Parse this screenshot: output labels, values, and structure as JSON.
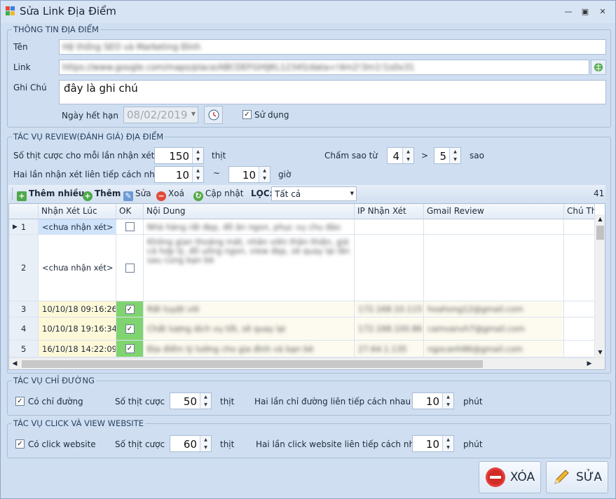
{
  "window": {
    "title": "Sửa Link Địa Điểm"
  },
  "info": {
    "legend": "THÔNG TIN ĐỊA ĐIỂM",
    "name_label": "Tên",
    "name_value": "Hệ thống SEO và Marketing Đình",
    "link_label": "Link",
    "link_value": "https://www.google.com/maps/place/ABCDEFGHIJKL12345/data=!4m2!3m1!1s0x31",
    "note_label": "Ghi Chú",
    "note_value": "đây là ghi chú",
    "expiry_label": "Ngày hết hạn",
    "expiry_value": "08/02/2019",
    "use_label": "Sử dụng"
  },
  "review": {
    "legend": "TÁC VỤ REVIEW(ĐÁNH GIÁ) ĐỊA ĐIỂM",
    "likes_label": "Số thịt cược cho mỗi lần nhận xét",
    "likes_value": "150",
    "likes_unit": "thịt",
    "interval_label": "Hai lần nhận xét liên tiếp cách nhau",
    "interval_from": "10",
    "interval_sep": "~",
    "interval_to": "10",
    "interval_unit": "giờ",
    "stars_label": "Chấm sao từ",
    "stars_from": "4",
    "stars_sep": ">",
    "stars_to": "5",
    "stars_unit": "sao"
  },
  "toolbar": {
    "add_many": "Thêm nhiều",
    "add": "Thêm",
    "edit": "Sửa",
    "delete": "Xoá",
    "update": "Cập nhật",
    "filter_label": "LỌC:",
    "filter_value": "Tất cả",
    "count": "41"
  },
  "grid": {
    "headers": [
      "Nhận Xét Lúc",
      "OK",
      "Nội Dung",
      "IP Nhận Xét",
      "Gmail Review",
      "Chú Thích"
    ],
    "rows": [
      {
        "num": "1",
        "time": "<chưa nhận xét>",
        "ok": false,
        "content": "Nhà hàng rất đẹp, đồ ăn ngon, phục vụ chu đáo",
        "ip": "",
        "gmail": ""
      },
      {
        "num": "2",
        "time": "<chưa nhận xét>",
        "ok": false,
        "content": "Không gian thoáng mát, nhân viên thân thiện, giá cả hợp lý, đồ uống ngon, view đẹp, sẽ quay lại lần sau cùng bạn bè",
        "ip": "",
        "gmail": ""
      },
      {
        "num": "3",
        "time": "10/10/18 09:16:26",
        "ok": true,
        "content": "Rất tuyệt vời",
        "ip": "172.168.10.115",
        "gmail": "hoahong12@gmail.com"
      },
      {
        "num": "4",
        "time": "10/10/18 19:16:34",
        "ok": true,
        "content": "Chất lượng dịch vụ tốt, sẽ quay lại",
        "ip": "172.168.100.86",
        "gmail": "camvanvh7@gmail.com"
      },
      {
        "num": "5",
        "time": "16/10/18 14:22:09",
        "ok": true,
        "content": "Địa điểm lý tưởng cho gia đình và bạn bè",
        "ip": "27.64.1.135",
        "gmail": "ngocanh86@gmail.com"
      }
    ]
  },
  "direction": {
    "legend": "TÁC VỤ CHỈ ĐƯỜNG",
    "check_label": "Có chỉ đường",
    "likes_label": "Số thịt cược",
    "likes_value": "50",
    "likes_unit": "thịt",
    "interval_label": "Hai lần chỉ đường liên tiếp cách nhau",
    "interval_value": "10",
    "interval_unit": "phút"
  },
  "website": {
    "legend": "TÁC VỤ CLICK VÀ VIEW WEBSITE",
    "check_label": "Có click website",
    "likes_label": "Số thịt cược",
    "likes_value": "60",
    "likes_unit": "thịt",
    "interval_label": "Hai lần click website liên tiếp cách nhau",
    "interval_value": "10",
    "interval_unit": "phút"
  },
  "buttons": {
    "delete": "XÓA",
    "save": "SỬA"
  }
}
